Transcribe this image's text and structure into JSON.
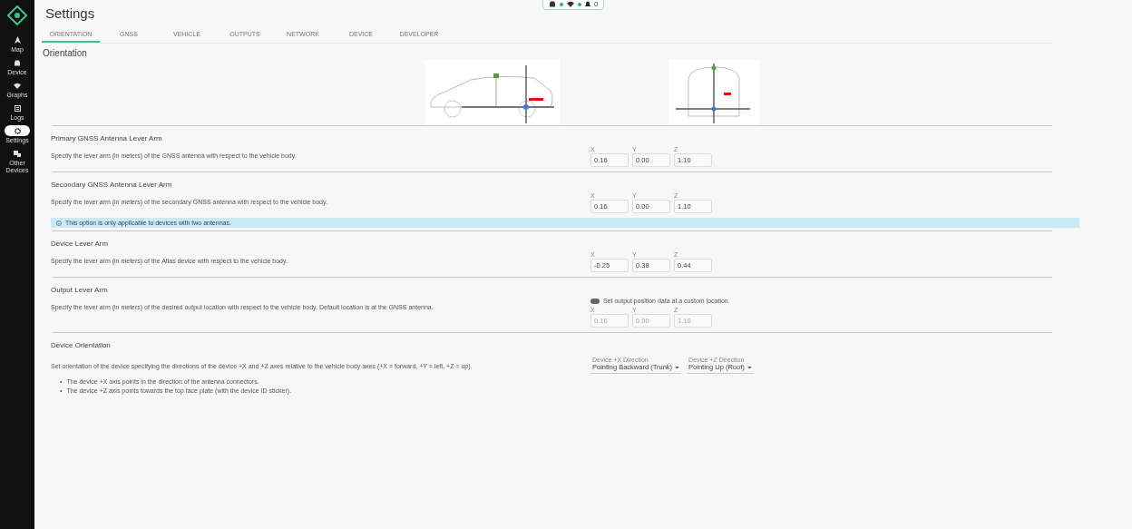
{
  "sidebar": {
    "items": [
      {
        "label": "Map",
        "selected": false
      },
      {
        "label": "Device",
        "selected": false
      },
      {
        "label": "Graphs",
        "selected": false
      },
      {
        "label": "Logs",
        "selected": false
      },
      {
        "label": "Settings",
        "selected": true
      },
      {
        "label": "Other Devices",
        "selected": false
      }
    ]
  },
  "status": {
    "indicators": [
      {
        "color": "#1db36b"
      },
      {
        "color": "#1db36b"
      }
    ],
    "notifications": "0"
  },
  "title": "Settings",
  "tabs": [
    {
      "label": "ORIENTATION",
      "selected": true
    },
    {
      "label": "GNSS",
      "selected": false
    },
    {
      "label": "VEHICLE",
      "selected": false
    },
    {
      "label": "OUTPUTS",
      "selected": false
    },
    {
      "label": "NETWORK",
      "selected": false
    },
    {
      "label": "DEVICE",
      "selected": false
    },
    {
      "label": "DEVELOPER",
      "selected": false
    }
  ],
  "heading": "Orientation",
  "sections": [
    {
      "kind": "lever",
      "title": "Primary GNSS Antenna Lever Arm",
      "description": "Specify the lever arm (in meters) of the GNSS antenna with respect to the vehicle body.",
      "fields": [
        {
          "label": "X",
          "value": "0.16",
          "disabled": false
        },
        {
          "label": "Y",
          "value": "0.00",
          "disabled": false
        },
        {
          "label": "Z",
          "value": "1.10",
          "disabled": false
        }
      ]
    },
    {
      "kind": "lever",
      "title": "Secondary GNSS Antenna Lever Arm",
      "description": "Specify the lever arm (in meters) of the secondary GNSS antenna with respect to the vehicle body.",
      "fields": [
        {
          "label": "X",
          "value": "0.16",
          "disabled": false
        },
        {
          "label": "Y",
          "value": "0.00",
          "disabled": false
        },
        {
          "label": "Z",
          "value": "1.10",
          "disabled": false
        }
      ],
      "info": "This option is only applicable to devices with two antennas."
    },
    {
      "kind": "lever",
      "title": "Device Lever Arm",
      "description": "Specify the lever arm (in meters) of the Atlas device with respect to the vehicle body.",
      "fields": [
        {
          "label": "X",
          "value": "-0.25",
          "disabled": false
        },
        {
          "label": "Y",
          "value": "0.38",
          "disabled": false
        },
        {
          "label": "Z",
          "value": "0.44",
          "disabled": false
        }
      ]
    },
    {
      "kind": "lever",
      "title": "Output Lever Arm",
      "description": "Specify the lever arm (in meters) of the desired output location with respect to the vehicle body. Default location is at the GNSS antenna.",
      "toggle": {
        "label": "Set output position data at a custom location.",
        "on": false
      },
      "fields": [
        {
          "label": "X",
          "value": "0.16",
          "disabled": true
        },
        {
          "label": "Y",
          "value": "0.00",
          "disabled": true
        },
        {
          "label": "Z",
          "value": "1.10",
          "disabled": true
        }
      ]
    },
    {
      "kind": "orientation",
      "title": "Device Orientation",
      "description": "Set orientation of the device specifying the directions of the device +X and +Z axes relative to the vehicle body axes (+X = forward, +Y = left, +Z = up).",
      "bullets": [
        {
          "marker": "•",
          "text": "The device +X axis points in the direction of the antenna connectors."
        },
        {
          "marker": "•",
          "text": "The device +Z axis points towards the top face plate (with the device ID sticker)."
        }
      ],
      "selects": [
        {
          "label": "Device +X Direction",
          "value": "Pointing Backward (Trunk)"
        },
        {
          "label": "Device +Z Direction",
          "value": "Pointing Up (Roof)"
        }
      ]
    }
  ]
}
